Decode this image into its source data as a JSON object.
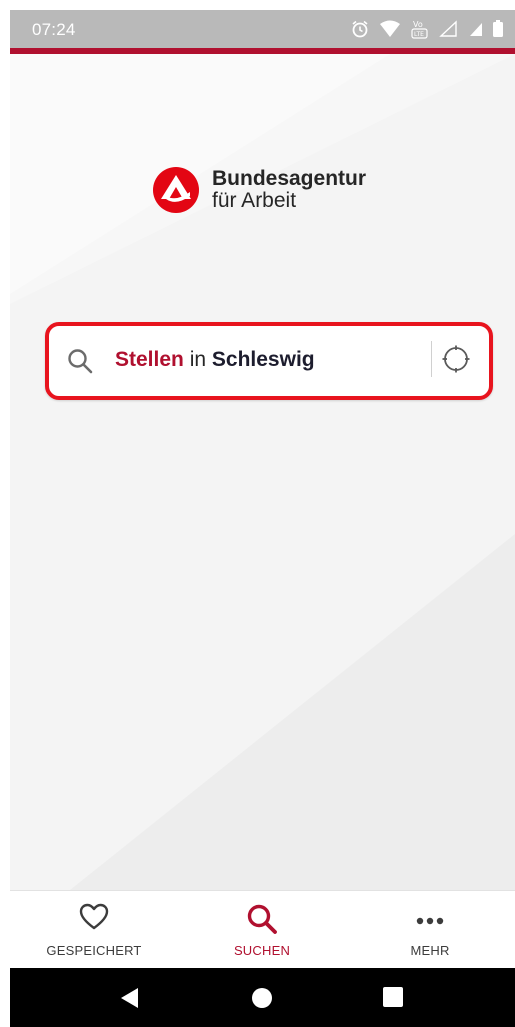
{
  "status_bar": {
    "time": "07:24",
    "icons": [
      "alarm-icon",
      "wifi-icon",
      "volte-icon",
      "signal-empty-icon",
      "signal-icon",
      "battery-icon"
    ]
  },
  "brand": {
    "line1": "Bundesagentur",
    "line2": "für Arbeit",
    "accent_color": "#b0102f",
    "logo_red": "#e30613"
  },
  "search": {
    "job_term": "Stellen",
    "connector": "in",
    "location": "Schleswig",
    "highlight_color": "#e8141e"
  },
  "bottom_nav": {
    "items": [
      {
        "label": "GESPEICHERT",
        "icon": "heart-icon",
        "active": false
      },
      {
        "label": "SUCHEN",
        "icon": "search-icon",
        "active": true
      },
      {
        "label": "MEHR",
        "icon": "more-icon",
        "active": false
      }
    ]
  },
  "system_nav": [
    "back-icon",
    "home-icon",
    "recents-icon"
  ]
}
